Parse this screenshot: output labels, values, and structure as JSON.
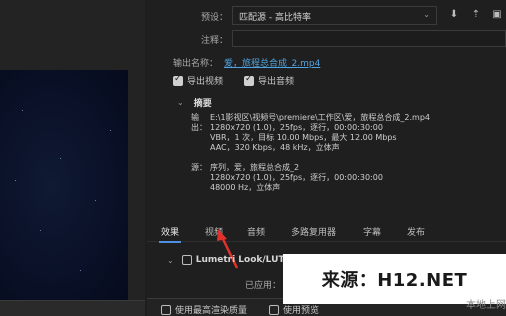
{
  "preset": {
    "label": "预设：",
    "value": "匹配源 - 高比特率"
  },
  "comment": {
    "label": "注释：",
    "value": ""
  },
  "output_name": {
    "label": "输出名称：",
    "value": "爱，旅程总合成_2.mp4"
  },
  "export_video": {
    "label": "导出视频",
    "checked": true
  },
  "export_audio": {
    "label": "导出音频",
    "checked": true
  },
  "summary": {
    "title": "摘要",
    "output_key": "输出：",
    "output_lines": [
      "E:\\1影视区\\视频号\\premiere\\工作区\\爱，旅程总合成_2.mp4",
      "1280x720 (1.0)，25fps，逐行，00:00:30:00",
      "VBR，1 次，目标 10.00 Mbps，最大 12.00 Mbps",
      "AAC，320 Kbps，48 kHz，立体声"
    ],
    "source_key": "源：",
    "source_lines": [
      "序列，爱，旅程总合成_2",
      "1280x720 (1.0)，25fps，逐行，00:00:30:00",
      "48000 Hz，立体声"
    ]
  },
  "tabs": [
    {
      "label": "效果",
      "active": true
    },
    {
      "label": "视频",
      "active": false
    },
    {
      "label": "音频",
      "active": false
    },
    {
      "label": "多路复用器",
      "active": false
    },
    {
      "label": "字幕",
      "active": false
    },
    {
      "label": "发布",
      "active": false
    }
  ],
  "lumetri": {
    "label": "Lumetri Look/LUT",
    "applied_label": "已应用："
  },
  "bottom": {
    "max_render_quality": "使用最高渲染质量",
    "use_previews": "使用预览"
  },
  "watermark": {
    "text": "来源：H12.NET",
    "sub": "本地上网"
  },
  "colors": {
    "accent": "#4d8fe0",
    "link": "#4fa3e0",
    "arrow": "#e0312b"
  }
}
